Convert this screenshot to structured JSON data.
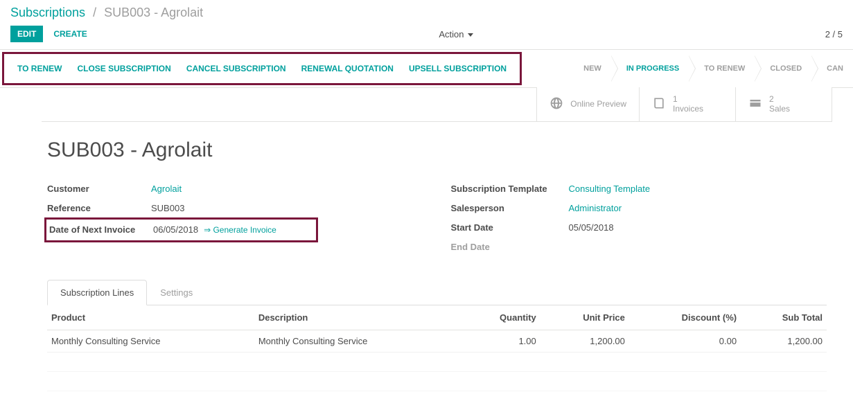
{
  "breadcrumb": {
    "root": "Subscriptions",
    "current": "SUB003 - Agrolait"
  },
  "controls": {
    "edit": "EDIT",
    "create": "CREATE",
    "action": "Action",
    "pager": "2 / 5"
  },
  "header_buttons": {
    "to_renew": "TO RENEW",
    "close_subscription": "CLOSE SUBSCRIPTION",
    "cancel_subscription": "CANCEL SUBSCRIPTION",
    "renewal_quotation": "RENEWAL QUOTATION",
    "upsell_subscription": "UPSELL SUBSCRIPTION"
  },
  "statusbar": {
    "new": "NEW",
    "in_progress": "IN PROGRESS",
    "to_renew": "TO RENEW",
    "closed": "CLOSED",
    "cancelled": "CAN"
  },
  "stat_buttons": {
    "online_preview": {
      "label": "Online Preview"
    },
    "invoices": {
      "count": "1",
      "label": "Invoices"
    },
    "sales": {
      "count": "2",
      "label": "Sales"
    }
  },
  "record": {
    "title": "SUB003 - Agrolait",
    "fields_left": {
      "customer_label": "Customer",
      "customer_value": "Agrolait",
      "reference_label": "Reference",
      "reference_value": "SUB003",
      "next_invoice_label": "Date of Next Invoice",
      "next_invoice_value": "06/05/2018",
      "generate_invoice": "⇒ Generate Invoice"
    },
    "fields_right": {
      "template_label": "Subscription Template",
      "template_value": "Consulting Template",
      "salesperson_label": "Salesperson",
      "salesperson_value": "Administrator",
      "start_date_label": "Start Date",
      "start_date_value": "05/05/2018",
      "end_date_label": "End Date",
      "end_date_value": ""
    }
  },
  "tabs": {
    "lines": "Subscription Lines",
    "settings": "Settings"
  },
  "table": {
    "headers": {
      "product": "Product",
      "description": "Description",
      "quantity": "Quantity",
      "unit_price": "Unit Price",
      "discount": "Discount (%)",
      "subtotal": "Sub Total"
    },
    "rows": [
      {
        "product": "Monthly Consulting Service",
        "description": "Monthly Consulting Service",
        "quantity": "1.00",
        "unit_price": "1,200.00",
        "discount": "0.00",
        "subtotal": "1,200.00"
      }
    ]
  }
}
